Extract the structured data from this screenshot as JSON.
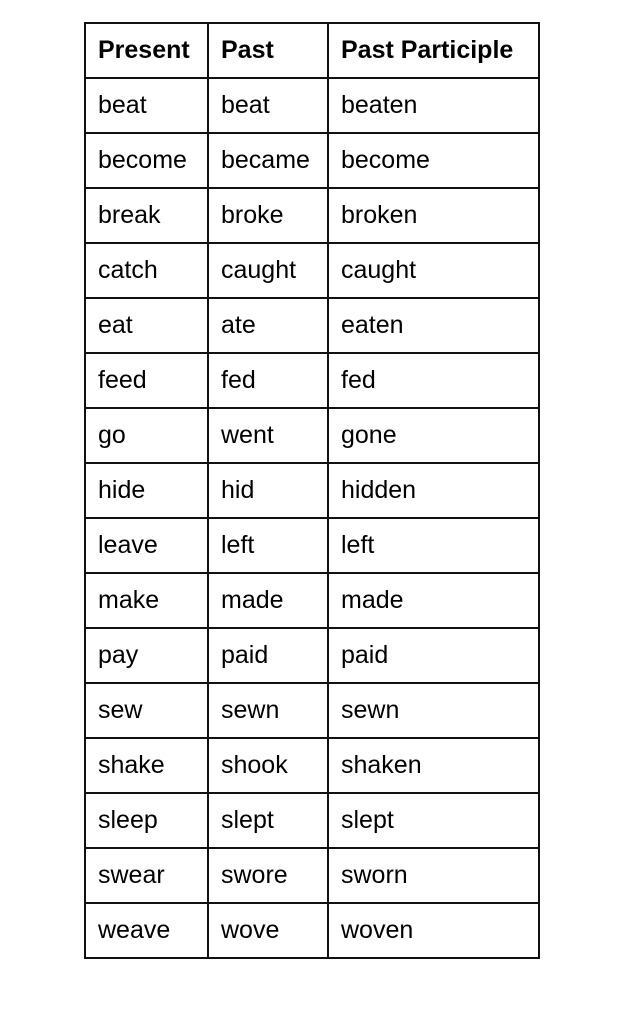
{
  "table": {
    "headers": [
      "Present",
      "Past",
      "Past Participle"
    ],
    "rows": [
      [
        "beat",
        "beat",
        "beaten"
      ],
      [
        "become",
        "became",
        "become"
      ],
      [
        "break",
        "broke",
        "broken"
      ],
      [
        "catch",
        "caught",
        "caught"
      ],
      [
        "eat",
        "ate",
        "eaten"
      ],
      [
        "feed",
        "fed",
        "fed"
      ],
      [
        "go",
        "went",
        "gone"
      ],
      [
        "hide",
        "hid",
        "hidden"
      ],
      [
        "leave",
        "left",
        "left"
      ],
      [
        "make",
        "made",
        "made"
      ],
      [
        "pay",
        "paid",
        "paid"
      ],
      [
        "sew",
        "sewn",
        "sewn"
      ],
      [
        "shake",
        "shook",
        "shaken"
      ],
      [
        "sleep",
        "slept",
        "slept"
      ],
      [
        "swear",
        "swore",
        "sworn"
      ],
      [
        "weave",
        "wove",
        "woven"
      ]
    ]
  }
}
